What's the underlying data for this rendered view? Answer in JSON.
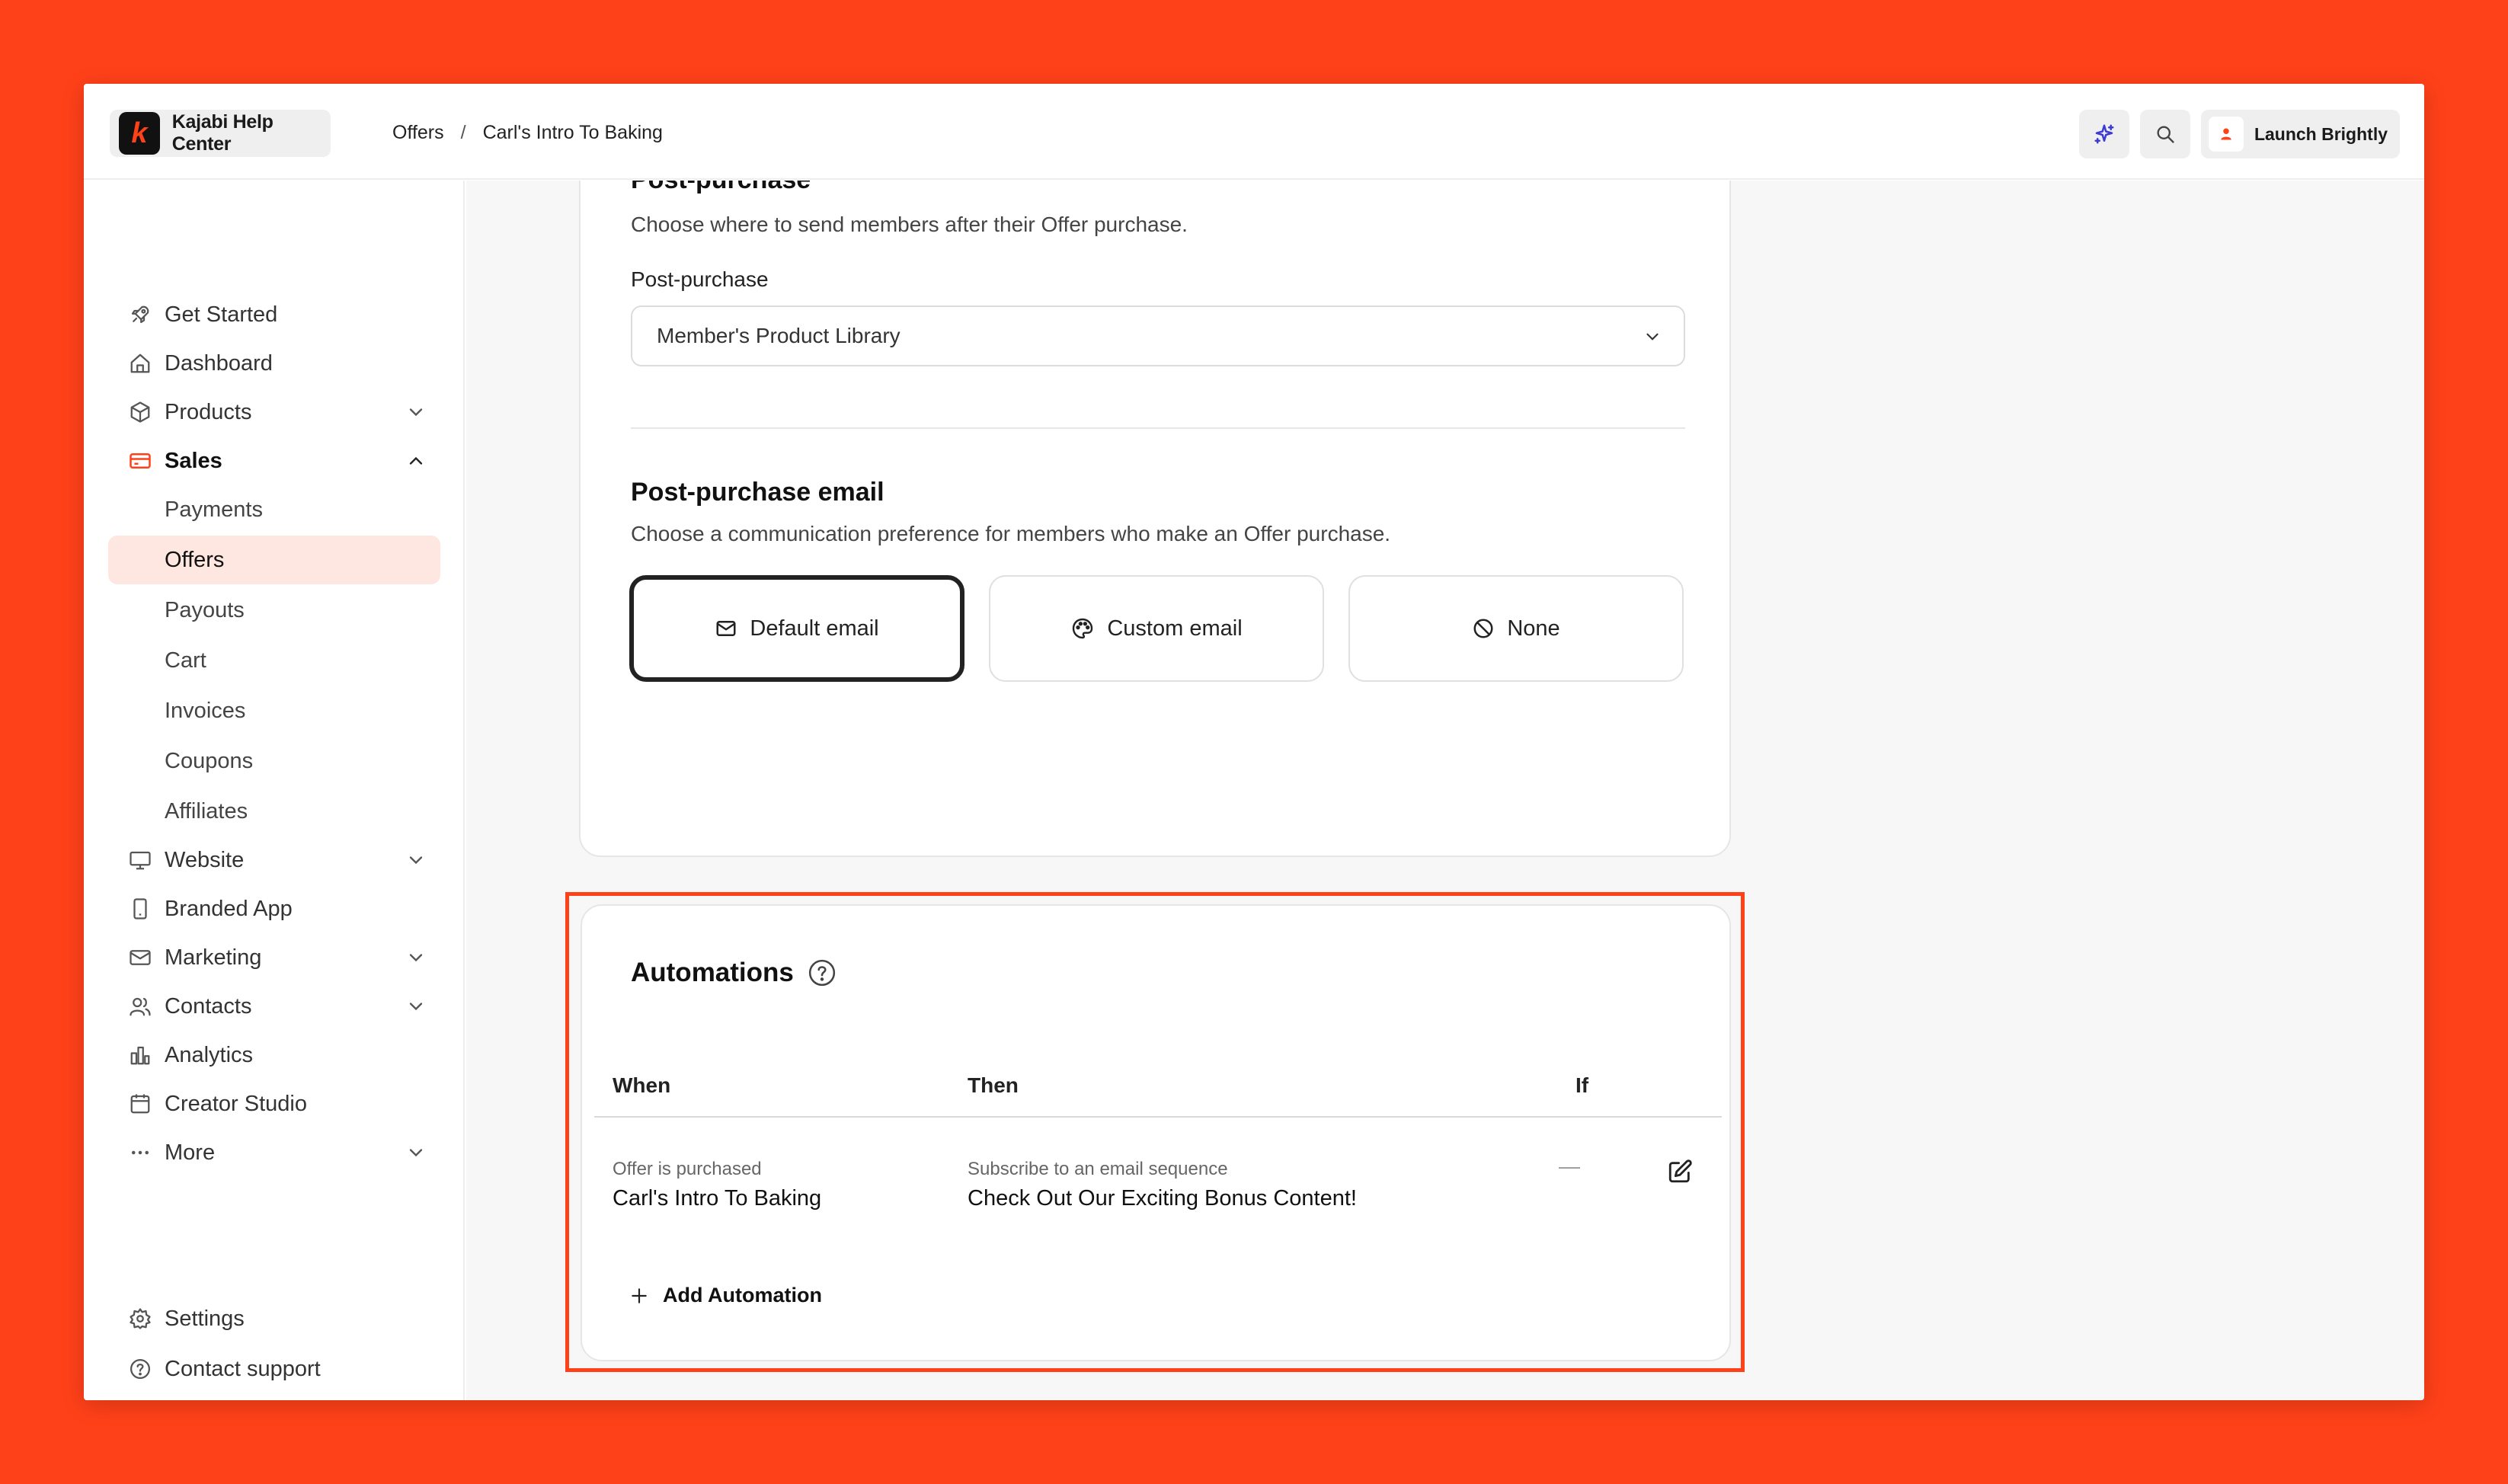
{
  "app": {
    "name": "Kajabi Help Center",
    "logo_letter": "k"
  },
  "breadcrumb": {
    "parent": "Offers",
    "separator": "/",
    "current": "Carl's Intro To Baking"
  },
  "topbar": {
    "ai_icon": "sparkle-icon",
    "search_icon": "search-icon",
    "account_label": "Launch Brightly"
  },
  "colors": {
    "background": "#FF4119",
    "accent": "#FF4119",
    "active_nav_bg": "#FFE7E1",
    "ai_icon": "#3D3BD6"
  },
  "sidebar": {
    "items": [
      {
        "label": "Get Started",
        "icon": "rocket-icon"
      },
      {
        "label": "Dashboard",
        "icon": "home-icon"
      },
      {
        "label": "Products",
        "icon": "box-icon"
      },
      {
        "label": "Sales",
        "icon": "card-icon"
      },
      {
        "label": "Website",
        "icon": "monitor-icon"
      },
      {
        "label": "Branded App",
        "icon": "phone-icon"
      },
      {
        "label": "Marketing",
        "icon": "mail-icon"
      },
      {
        "label": "Contacts",
        "icon": "users-icon"
      },
      {
        "label": "Analytics",
        "icon": "bar-chart-icon"
      },
      {
        "label": "Creator Studio",
        "icon": "calendar-icon"
      },
      {
        "label": "More",
        "icon": "more-icon"
      }
    ],
    "sales_subitems": [
      "Payments",
      "Offers",
      "Payouts",
      "Cart",
      "Invoices",
      "Coupons",
      "Affiliates"
    ],
    "footer": [
      {
        "label": "Settings",
        "icon": "gear-icon"
      },
      {
        "label": "Contact support",
        "icon": "help-icon"
      }
    ]
  },
  "post_purchase": {
    "heading": "Post-purchase",
    "description": "Choose where to send members after their Offer purchase.",
    "field_label": "Post-purchase",
    "selected_value": "Member's Product Library"
  },
  "post_purchase_email": {
    "heading": "Post-purchase email",
    "description": "Choose a communication preference for members who make an Offer purchase.",
    "options": [
      "Default email",
      "Custom email",
      "None"
    ],
    "selected": "Default email"
  },
  "automations": {
    "title": "Automations",
    "columns": [
      "When",
      "Then",
      "If"
    ],
    "rows": [
      {
        "when_sub": "Offer is purchased",
        "when_main": "Carl's Intro To Baking",
        "then_sub": "Subscribe to an email sequence",
        "then_main": "Check Out Our Exciting Bonus Content!",
        "if": "—"
      }
    ],
    "add_label": "Add Automation"
  }
}
